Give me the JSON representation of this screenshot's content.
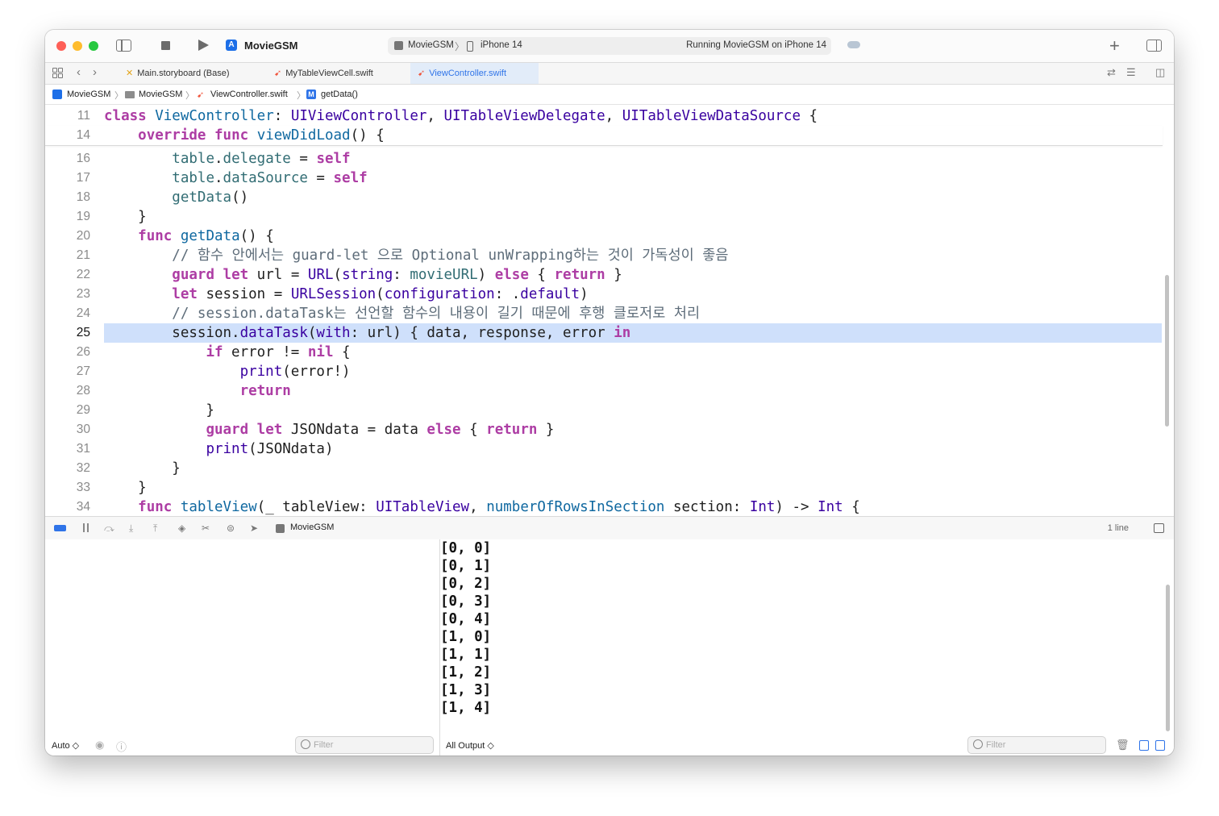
{
  "toolbar": {
    "project_title": "MovieGSM",
    "scheme": "MovieGSM",
    "device": "iPhone 14",
    "status": "Running MovieGSM on iPhone 14"
  },
  "tabs": [
    {
      "label": "Main.storyboard (Base)",
      "icon": "storyboard-icon"
    },
    {
      "label": "MyTableViewCell.swift",
      "icon": "swift-icon"
    },
    {
      "label": "ViewController.swift",
      "icon": "swift-icon",
      "active": true
    }
  ],
  "breadcrumb": [
    "MovieGSM",
    "MovieGSM",
    "ViewController.swift",
    "getData()"
  ],
  "editor": {
    "sticky_lines": [
      "11",
      "14"
    ],
    "line_numbers": [
      "16",
      "17",
      "18",
      "19",
      "20",
      "21",
      "22",
      "23",
      "24",
      "25",
      "26",
      "27",
      "28",
      "29",
      "30",
      "31",
      "32",
      "33",
      "34"
    ],
    "current_line": "25"
  },
  "debug": {
    "target": "MovieGSM",
    "line_count": "1 line"
  },
  "console": {
    "output": [
      "[0, 0]",
      "[0, 1]",
      "[0, 2]",
      "[0, 3]",
      "[0, 4]",
      "[1, 0]",
      "[1, 1]",
      "[1, 2]",
      "[1, 3]",
      "[1, 4]"
    ],
    "variables_mode": "Auto ◇",
    "output_mode": "All Output ◇",
    "filter_placeholder": "Filter"
  },
  "colors": {
    "keyword": "#ad3da4",
    "type": "#3900a0",
    "function": "#0f68a0",
    "property": "#326d74",
    "comment": "#5d6c79",
    "current_line_highlight": "#cfe0fb",
    "accent": "#2f74e8"
  }
}
